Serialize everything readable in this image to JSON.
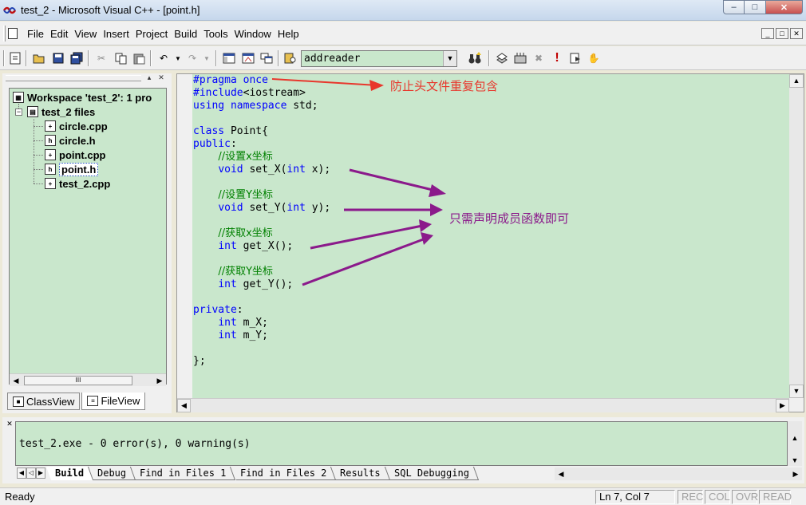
{
  "window": {
    "title": "test_2 - Microsoft Visual C++ - [point.h]",
    "min_glyph": "‒",
    "max_glyph": "□",
    "close_glyph": "✕"
  },
  "menu": {
    "items": [
      "File",
      "Edit",
      "View",
      "Insert",
      "Project",
      "Build",
      "Tools",
      "Window",
      "Help"
    ]
  },
  "toolbar": {
    "combo_value": "addreader",
    "combo_arrow": "▼"
  },
  "workspace": {
    "tree": {
      "root": "Workspace 'test_2': 1 pro",
      "project": "test_2 files",
      "files": [
        "circle.cpp",
        "circle.h",
        "point.cpp",
        "point.h",
        "test_2.cpp"
      ],
      "selected_file": "point.h"
    },
    "tabs": [
      "ClassView",
      "FileView"
    ],
    "active_tab": "FileView",
    "scroll_thumb": "III"
  },
  "editor": {
    "lines": [
      {
        "parts": [
          [
            "pp",
            "#pragma once"
          ]
        ]
      },
      {
        "parts": [
          [
            "pp",
            "#include"
          ],
          [
            "",
            "<iostream>"
          ]
        ]
      },
      {
        "parts": [
          [
            "kw",
            "using namespace"
          ],
          [
            "",
            " std;"
          ]
        ]
      },
      {
        "parts": []
      },
      {
        "parts": [
          [
            "kw",
            "class"
          ],
          [
            "",
            " Point{"
          ]
        ]
      },
      {
        "parts": [
          [
            "kw",
            "public"
          ],
          [
            "",
            ":"
          ]
        ]
      },
      {
        "parts": [
          [
            "",
            "    "
          ],
          [
            "cm",
            "//设置x坐标"
          ]
        ]
      },
      {
        "parts": [
          [
            "",
            "    "
          ],
          [
            "kw",
            "void"
          ],
          [
            "",
            " set_X("
          ],
          [
            "kw",
            "int"
          ],
          [
            "",
            " x);"
          ]
        ]
      },
      {
        "parts": []
      },
      {
        "parts": [
          [
            "",
            "    "
          ],
          [
            "cm",
            "//设置Y坐标"
          ]
        ]
      },
      {
        "parts": [
          [
            "",
            "    "
          ],
          [
            "kw",
            "void"
          ],
          [
            "",
            " set_Y("
          ],
          [
            "kw",
            "int"
          ],
          [
            "",
            " y);"
          ]
        ]
      },
      {
        "parts": []
      },
      {
        "parts": [
          [
            "",
            "    "
          ],
          [
            "cm",
            "//获取x坐标"
          ]
        ]
      },
      {
        "parts": [
          [
            "",
            "    "
          ],
          [
            "kw",
            "int"
          ],
          [
            "",
            " get_X();"
          ]
        ]
      },
      {
        "parts": []
      },
      {
        "parts": [
          [
            "",
            "    "
          ],
          [
            "cm",
            "//获取Y坐标"
          ]
        ]
      },
      {
        "parts": [
          [
            "",
            "    "
          ],
          [
            "kw",
            "int"
          ],
          [
            "",
            " get_Y();"
          ]
        ]
      },
      {
        "parts": []
      },
      {
        "parts": [
          [
            "kw",
            "private"
          ],
          [
            "",
            ":"
          ]
        ]
      },
      {
        "parts": [
          [
            "",
            "    "
          ],
          [
            "kw",
            "int"
          ],
          [
            "",
            " m_X;"
          ]
        ]
      },
      {
        "parts": [
          [
            "",
            "    "
          ],
          [
            "kw",
            "int"
          ],
          [
            "",
            " m_Y;"
          ]
        ]
      },
      {
        "parts": []
      },
      {
        "parts": [
          [
            "",
            "};"
          ]
        ]
      }
    ],
    "annotations": {
      "pragma_note": "防止头文件重复包含",
      "members_note": "只需声明成员函数即可"
    },
    "colors": {
      "background": "#c9e7cc",
      "keyword": "#0000ff",
      "comment": "#008000",
      "annotation_red": "#e8372c",
      "annotation_purple": "#8b1a8b"
    }
  },
  "output": {
    "text": "test_2.exe - 0 error(s), 0 warning(s)",
    "tabs": [
      "Build",
      "Debug",
      "Find in Files 1",
      "Find in Files 2",
      "Results",
      "SQL Debugging"
    ],
    "active_tab": "Build"
  },
  "status": {
    "message": "Ready",
    "position": "Ln 7, Col 7",
    "indicators": [
      "REC",
      "COL",
      "OVR",
      "READ"
    ]
  }
}
